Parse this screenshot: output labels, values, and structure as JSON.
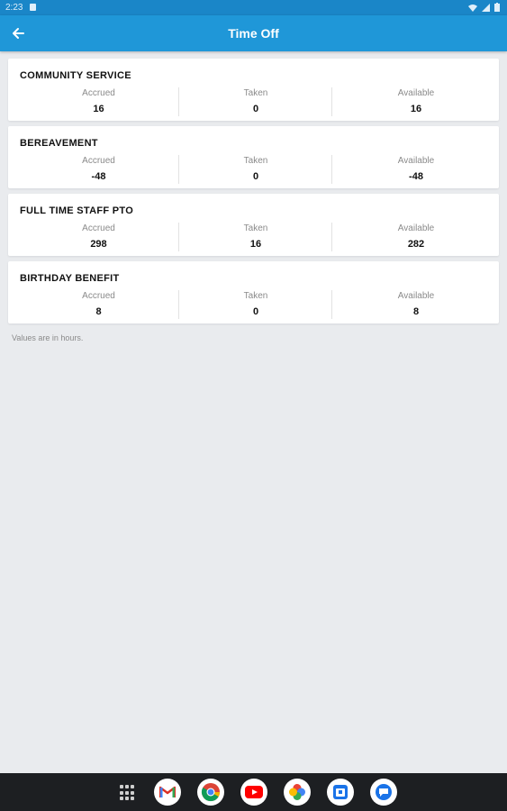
{
  "status_bar": {
    "time": "2:23"
  },
  "app_bar": {
    "back_icon": "arrow-left-icon",
    "title": "Time Off"
  },
  "cards": [
    {
      "title": "COMMUNITY SERVICE",
      "accrued_label": "Accrued",
      "accrued": "16",
      "taken_label": "Taken",
      "taken": "0",
      "available_label": "Available",
      "available": "16"
    },
    {
      "title": "BEREAVEMENT",
      "accrued_label": "Accrued",
      "accrued": "-48",
      "taken_label": "Taken",
      "taken": "0",
      "available_label": "Available",
      "available": "-48"
    },
    {
      "title": "FULL TIME STAFF PTO",
      "accrued_label": "Accrued",
      "accrued": "298",
      "taken_label": "Taken",
      "taken": "16",
      "available_label": "Available",
      "available": "282"
    },
    {
      "title": "BIRTHDAY BENEFIT",
      "accrued_label": "Accrued",
      "accrued": "8",
      "taken_label": "Taken",
      "taken": "0",
      "available_label": "Available",
      "available": "8"
    }
  ],
  "footnote": "Values are in hours.",
  "colors": {
    "app_bar": "#1f97d8",
    "background": "#e9ebee",
    "nav_bar": "#1d1f22"
  },
  "dock": {
    "apps": [
      {
        "name": "gmail-icon"
      },
      {
        "name": "chrome-icon"
      },
      {
        "name": "youtube-icon"
      },
      {
        "name": "photos-icon"
      },
      {
        "name": "calendar-app-icon"
      },
      {
        "name": "messages-icon"
      }
    ]
  }
}
